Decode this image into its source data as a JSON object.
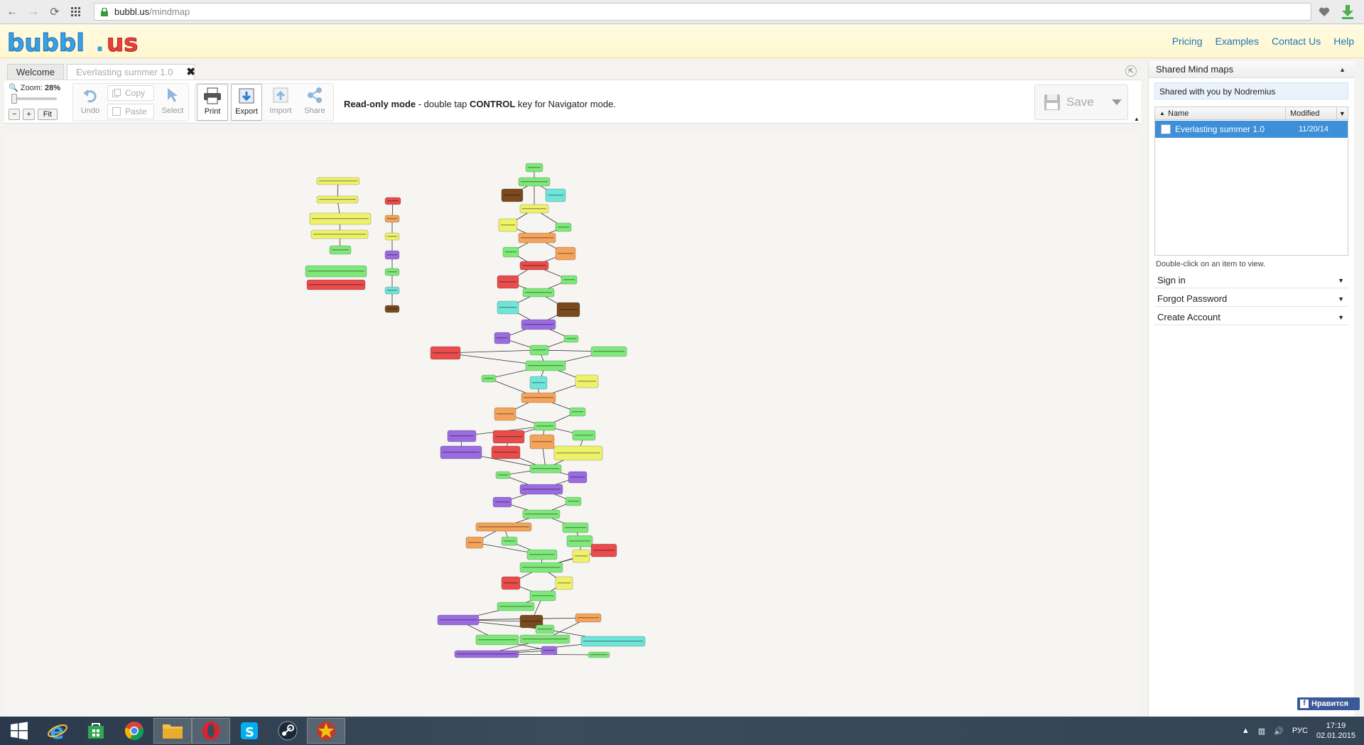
{
  "browser": {
    "url_host": "bubbl.us",
    "url_path": "/mindmap"
  },
  "site": {
    "logo_text": "bubbl.us",
    "nav": [
      "Pricing",
      "Examples",
      "Contact Us",
      "Help"
    ]
  },
  "tabs": {
    "welcome": "Welcome",
    "active": "Everlasting summer 1.0",
    "close": "✖"
  },
  "toolbar": {
    "zoom_label": "Zoom:",
    "zoom_value": "28%",
    "zoom_minus": "−",
    "zoom_plus": "+",
    "zoom_fit": "Fit",
    "undo": "Undo",
    "copy": "Copy",
    "paste": "Paste",
    "select": "Select",
    "print": "Print",
    "export": "Export",
    "import": "Import",
    "share": "Share",
    "readonly_bold": "Read-only mode",
    "readonly_mid": " - double tap ",
    "readonly_key": "CONTROL",
    "readonly_tail": " key for Navigator mode.",
    "save": "Save"
  },
  "side_panel": {
    "shared_title": "Shared Mind maps",
    "shared_by": "Shared with you by Nodremius",
    "col_name": "Name",
    "col_modified": "Modified",
    "rows": [
      {
        "name": "Everlasting summer 1.0",
        "modified": "11/20/14"
      }
    ],
    "hint": "Double-click on an item to view.",
    "sign_in": "Sign in",
    "forgot_password": "Forgot Password",
    "create_account": "Create Account"
  },
  "like_button": "Нравится",
  "taskbar": {
    "lang": "РУС",
    "time": "17:19",
    "date": "02.01.2015"
  },
  "colors": {
    "green": "#7ee87a",
    "yellow": "#eef26a",
    "red": "#e84c4c",
    "orange": "#f4a35a",
    "purple": "#9b6be0",
    "cyan": "#6fe4d8",
    "brown": "#7a4a1e",
    "link": "#1f75b7",
    "selection": "#3d8fd9"
  }
}
